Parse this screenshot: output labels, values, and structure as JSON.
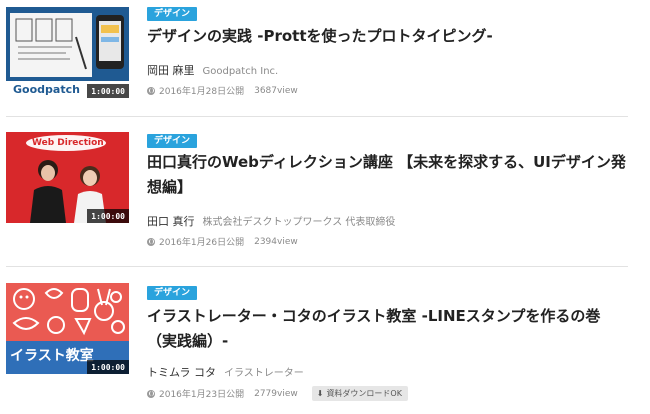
{
  "items": [
    {
      "category": "デザイン",
      "title": "デザインの実践 -Prottを使ったプロトタイピング-",
      "author": "岡田 麻里",
      "affiliation": "Goodpatch Inc.",
      "date": "2016年1月28日公開",
      "views": "3687view",
      "duration": "1:00:00",
      "thumb_logo": "Goodpatch"
    },
    {
      "category": "デザイン",
      "title": "田口真行のWebディレクション講座 【未来を探求する、UIデザイン発想編】",
      "author": "田口 真行",
      "affiliation": "株式会社デスクトップワークス 代表取締役",
      "date": "2016年1月26日公開",
      "views": "2394view",
      "duration": "1:00:00",
      "thumb_sign": "Web Direction"
    },
    {
      "category": "デザイン",
      "title": "イラストレーター・コタのイラスト教室 -LINEスタンプを作るの巻（実践編）-",
      "author": "トミムラ コタ",
      "affiliation": "イラストレーター",
      "date": "2016年1月23日公開",
      "views": "2779view",
      "download_badge": "資料ダウンロードOK",
      "duration": "1:00:00",
      "thumb_caption": "イラスト教室"
    }
  ]
}
